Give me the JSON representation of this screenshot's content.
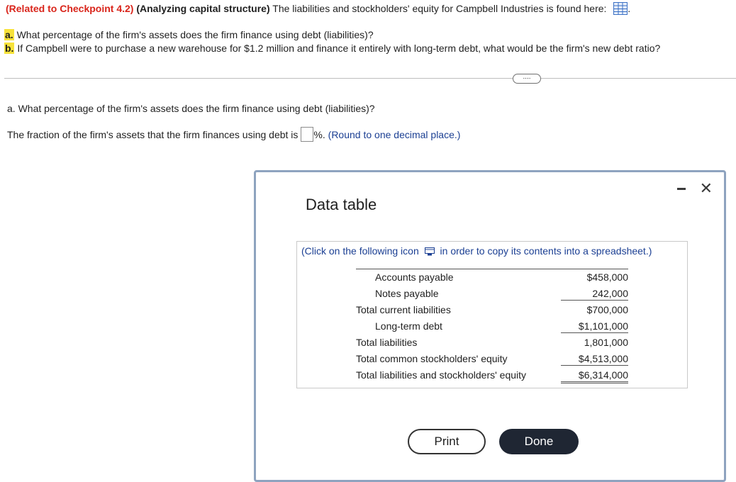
{
  "header": {
    "related": "(Related to Checkpoint 4.2)",
    "analyzing": "(Analyzing capital structure)",
    "text": "The liabilities and stockholders' equity for Campbell Industries is found here:",
    "period": "."
  },
  "questions": {
    "a_label": "a.",
    "a_text": "What percentage of the firm's assets does the firm finance using debt (liabilities)?",
    "b_label": "b.",
    "b_text": "If Campbell were to purchase a new warehouse for $1.2 million and finance it entirely with long-term debt, what would be the firm's new debt ratio?"
  },
  "more_label": "....",
  "part_a": {
    "question": "a. What percentage of the firm's assets does the firm finance using debt (liabilities)?",
    "answer_prefix": "The fraction of the firm's assets that the firm finances using debt is",
    "answer_value": "",
    "answer_suffix": "%.",
    "hint": "(Round to one decimal place.)"
  },
  "modal": {
    "title": "Data table",
    "instr_before": "(Click on the following icon",
    "instr_after": "in order to copy its contents into a spreadsheet.)",
    "rows": [
      {
        "label": "Accounts payable",
        "value": "$458,000"
      },
      {
        "label": "Notes payable",
        "value": "242,000"
      },
      {
        "label": "Total current liabilities",
        "value": "$700,000"
      },
      {
        "label": "Long-term debt",
        "value": "$1,101,000"
      },
      {
        "label": "Total liabilities",
        "value": "1,801,000"
      },
      {
        "label": "Total common stockholders' equity",
        "value": "$4,513,000"
      },
      {
        "label": "Total liabilities and stockholders' equity",
        "value": "$6,314,000"
      }
    ],
    "print_label": "Print",
    "done_label": "Done",
    "close_glyph": "✕"
  }
}
